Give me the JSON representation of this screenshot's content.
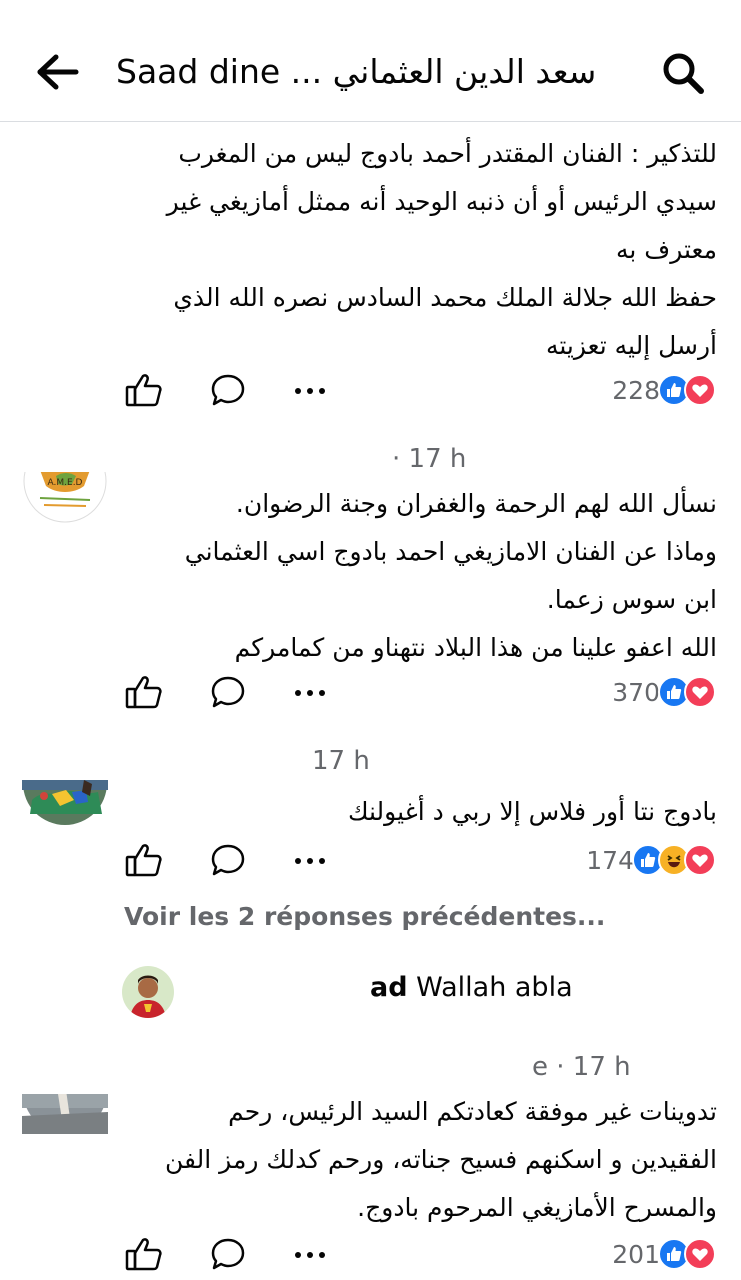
{
  "header": {
    "title": "Saad dine ... سعد الدين العثماني",
    "back_icon": "arrow-left-icon",
    "search_icon": "search-icon"
  },
  "comments": [
    {
      "lines": [
        "للتذكير : الفنان المقتدر أحمد بادوج ليس من المغرب",
        "سيدي الرئيس أو أن ذنبه الوحيد أنه ممثل أمازيغي غير",
        "معترف به",
        "حفظ الله جلالة الملك محمد السادس نصره الله الذي",
        "أرسل إليه تعزيته"
      ],
      "reaction_count": "228",
      "reactions": [
        "like",
        "love"
      ]
    },
    {
      "timestamp": "· 17 h",
      "avatar_label": "A.M.E.D",
      "lines": [
        "نسأل الله لهم الرحمة والغفران وجنة الرضوان.",
        "وماذا عن الفنان الامازيغي احمد بادوج اسي العثماني",
        "ابن سوس زعما.",
        "الله اعفو علينا من هذا البلاد نتهناو من كمامركم"
      ],
      "reaction_count": "370",
      "reactions": [
        "like",
        "love"
      ]
    },
    {
      "timestamp": "17 h",
      "lines": [
        "بادوج نتا أور فلاس إلا ربي  د أغيولنك"
      ],
      "reaction_count": "174",
      "reactions": [
        "like",
        "haha",
        "love"
      ]
    },
    {
      "timestamp": "e · 17 h",
      "lines": [
        "تدوينات غير موفقة كعادتكم السيد الرئيس، رحم",
        "الفقيدين و اسكنهم فسيح جناته، ورحم كدلك رمز الفن",
        "والمسرح الأمازيغي المرحوم بادوج."
      ],
      "reaction_count": "201",
      "reactions": [
        "like",
        "love"
      ]
    }
  ],
  "see_previous": "Voir les 2 réponses précédentes...",
  "reply": {
    "name_fragment": "ad",
    "text": " Wallah abla"
  },
  "colors": {
    "like_blue": "#1877f2",
    "love_red": "#f33e58",
    "haha_yellow": "#f7b125",
    "secondary_text": "#65676b"
  }
}
